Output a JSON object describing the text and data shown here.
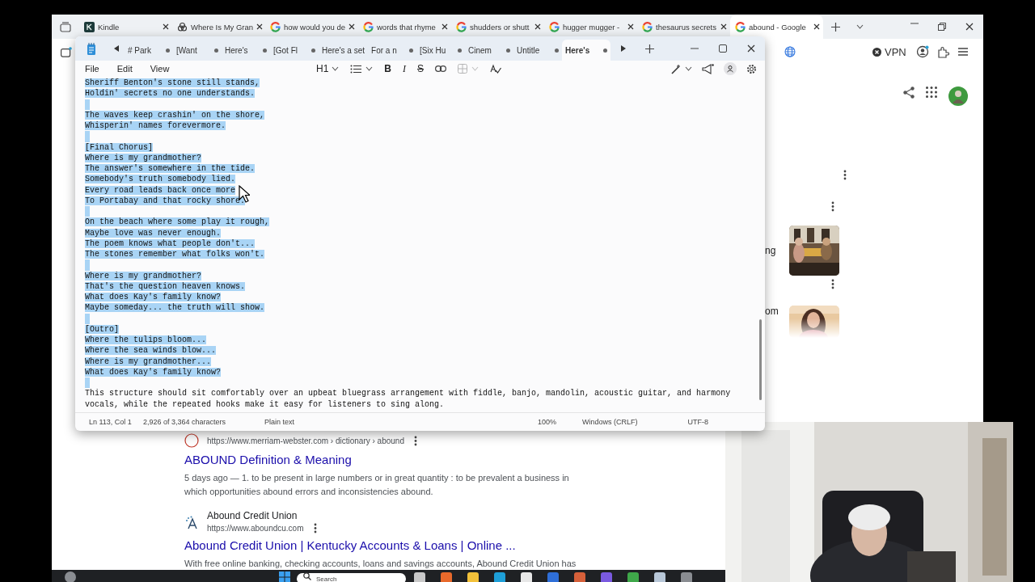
{
  "browser": {
    "tabs": [
      {
        "title": "Kindle",
        "kind": "book",
        "selected": false
      },
      {
        "title": "Where Is My Gran",
        "kind": "knot",
        "selected": false
      },
      {
        "title": "how would you de",
        "kind": "ring",
        "selected": false
      },
      {
        "title": "words that rhyme",
        "kind": "ring",
        "selected": false
      },
      {
        "title": "shudders or shutt",
        "kind": "ring",
        "selected": false
      },
      {
        "title": "hugger mugger - ",
        "kind": "ring",
        "selected": false
      },
      {
        "title": "thesaurus secrets",
        "kind": "ring",
        "selected": false
      },
      {
        "title": "abound - Google",
        "kind": "ring",
        "selected": true
      }
    ],
    "vpn_label": "VPN"
  },
  "page": {
    "side_snippets": [
      "ng",
      "om"
    ],
    "results": [
      {
        "kind": "circle",
        "url": "https://www.merriam-webster.com › dictionary › abound",
        "title": "ABOUND Definition & Meaning",
        "snippet": [
          "5 days ago — 1. to be present in large numbers or in great quantity : to be prevalent a business in",
          "which opportunities abound errors and inconsistencies abound."
        ]
      },
      {
        "kind": "dots",
        "site": "Abound Credit Union",
        "url": "https://www.aboundcu.com",
        "title": "Abound Credit Union | Kentucky Accounts & Loans | Online ...",
        "snippet": [
          "With free online banking, checking accounts, loans and savings accounts, Abound Credit Union has"
        ]
      }
    ]
  },
  "notepad": {
    "tabs": [
      {
        "title": "# Park",
        "unsaved": true,
        "selected": false
      },
      {
        "title": "[Want",
        "unsaved": true,
        "selected": false
      },
      {
        "title": "Here's",
        "unsaved": true,
        "selected": false
      },
      {
        "title": "[Got Fl",
        "unsaved": true,
        "selected": false
      },
      {
        "title": "Here's a set",
        "unsaved": false,
        "selected": false
      },
      {
        "title": "For a n",
        "unsaved": true,
        "selected": false
      },
      {
        "title": "[Six Hu",
        "unsaved": true,
        "selected": false
      },
      {
        "title": "Cinem",
        "unsaved": true,
        "selected": false
      },
      {
        "title": "Untitle",
        "unsaved": true,
        "selected": false
      },
      {
        "title": "Here's",
        "unsaved": true,
        "selected": true
      }
    ],
    "menu": [
      "File",
      "Edit",
      "View"
    ],
    "heading_button": "H1",
    "format_buttons": [
      {
        "label": "B",
        "kind": "bold"
      },
      {
        "label": "I",
        "kind": "italic"
      },
      {
        "label": "S",
        "kind": "strike"
      }
    ],
    "table_disabled": true,
    "stanzas": [
      {
        "selected": true,
        "lines": [
          "Sheriff Benton's stone still stands,",
          "Holdin' secrets no one understands."
        ]
      },
      {
        "selected": true,
        "lines": [
          "The waves keep crashin' on the shore,",
          "Whisperin' names forevermore."
        ]
      },
      {
        "selected": true,
        "lines": [
          "[Final Chorus]",
          "Where is my grandmother?",
          "The answer's somewhere in the tide.",
          "Somebody's truth somebody lied.",
          "Every road leads back once more",
          "To Portabay and that rocky shore."
        ]
      },
      {
        "selected": true,
        "lines": [
          "On the beach where some play it rough,",
          "Maybe love was never enough.",
          "The poem knows what people don't...",
          "The stones remember what folks won't."
        ]
      },
      {
        "selected": true,
        "lines": [
          "Where is my grandmother?",
          "That's the question heaven knows.",
          "What does Kay's family know?",
          "Maybe someday... the truth will show."
        ]
      },
      {
        "selected": true,
        "lines": [
          "[Outro]",
          "Where the tulips bloom...",
          "Where the sea winds blow...",
          "Where is my grandmother...",
          "What does Kay's family know?"
        ]
      },
      {
        "selected": false,
        "lines": [
          "This structure should sit comfortably over an upbeat bluegrass arrangement with fiddle, banjo, mandolin, acoustic guitar, and harmony",
          "vocals, while the repeated hooks make it easy for listeners to sing along."
        ]
      }
    ],
    "status": {
      "position": "Ln 113, Col 1",
      "count": "2,926 of 3,364 characters",
      "format": "Plain text",
      "zoom": "100%",
      "line_endings": "Windows (CRLF)",
      "encoding": "UTF-8"
    }
  },
  "taskbar": {
    "search_placeholder": "Search"
  }
}
